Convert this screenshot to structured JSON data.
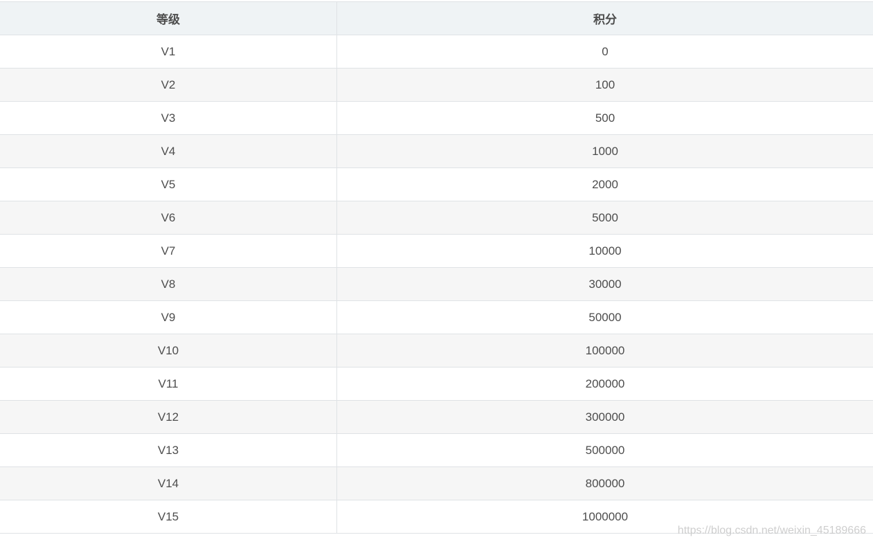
{
  "table": {
    "headers": [
      "等级",
      "积分"
    ],
    "rows": [
      [
        "V1",
        "0"
      ],
      [
        "V2",
        "100"
      ],
      [
        "V3",
        "500"
      ],
      [
        "V4",
        "1000"
      ],
      [
        "V5",
        "2000"
      ],
      [
        "V6",
        "5000"
      ],
      [
        "V7",
        "10000"
      ],
      [
        "V8",
        "30000"
      ],
      [
        "V9",
        "50000"
      ],
      [
        "V10",
        "100000"
      ],
      [
        "V11",
        "200000"
      ],
      [
        "V12",
        "300000"
      ],
      [
        "V13",
        "500000"
      ],
      [
        "V14",
        "800000"
      ],
      [
        "V15",
        "1000000"
      ]
    ]
  },
  "watermark": "https://blog.csdn.net/weixin_45189666"
}
